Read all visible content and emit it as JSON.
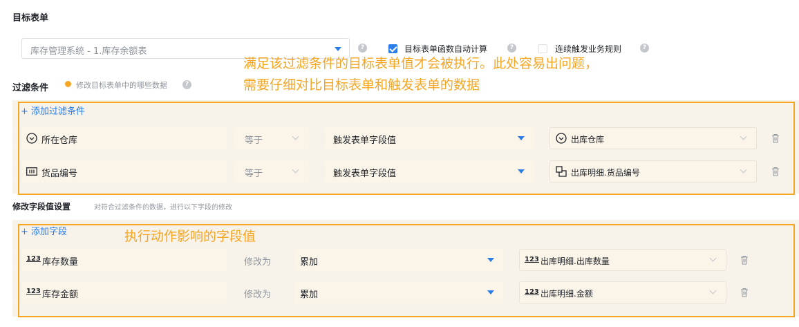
{
  "target_section": {
    "title": "目标表单",
    "form_select": {
      "value": "库存管理系统 - 1.库存余额表"
    },
    "auto_calc": {
      "label": "目标表单函数自动计算",
      "checked": true
    },
    "cascade": {
      "label": "连续触发业务规则",
      "checked": false
    }
  },
  "annotations": {
    "filter_note_line1": "满足该过滤条件的目标表单值才会被执行。此处容易出问题，",
    "filter_note_line2": "需要仔细对比目标表单和触发表单的数据",
    "fields_note": "执行动作影响的字段值"
  },
  "filter_section": {
    "title": "过滤条件",
    "hint": "修改目标表单中的哪些数据",
    "add_label": "+ 添加过滤条件",
    "rows": [
      {
        "field": "所在仓库",
        "field_icon": "circle-chevron-icon",
        "operator": "等于",
        "value_type": "触发表单字段值",
        "value": "出库仓库",
        "value_icon": "circle-chevron-icon"
      },
      {
        "field": "货品编号",
        "field_icon": "barcode-icon",
        "operator": "等于",
        "value_type": "触发表单字段值",
        "value": "出库明细.货品编号",
        "value_icon": "subform-icon"
      }
    ]
  },
  "modify_section": {
    "title": "修改字段值设置",
    "hint": "对符合过滤条件的数据，进行以下字段的修改",
    "add_label": "+ 添加字段",
    "rows": [
      {
        "field_icon_text": "123",
        "field": "库存数量",
        "action": "修改为",
        "mode": "累加",
        "value_icon_text": "123",
        "value": "出库明细.出库数量"
      },
      {
        "field_icon_text": "123",
        "field": "库存金额",
        "action": "修改为",
        "mode": "累加",
        "value_icon_text": "123",
        "value": "出库明细.金额"
      }
    ]
  },
  "colors": {
    "accent": "#2b7de9",
    "annotation": "#f5a623",
    "panel_bg": "#f7f2ea"
  }
}
